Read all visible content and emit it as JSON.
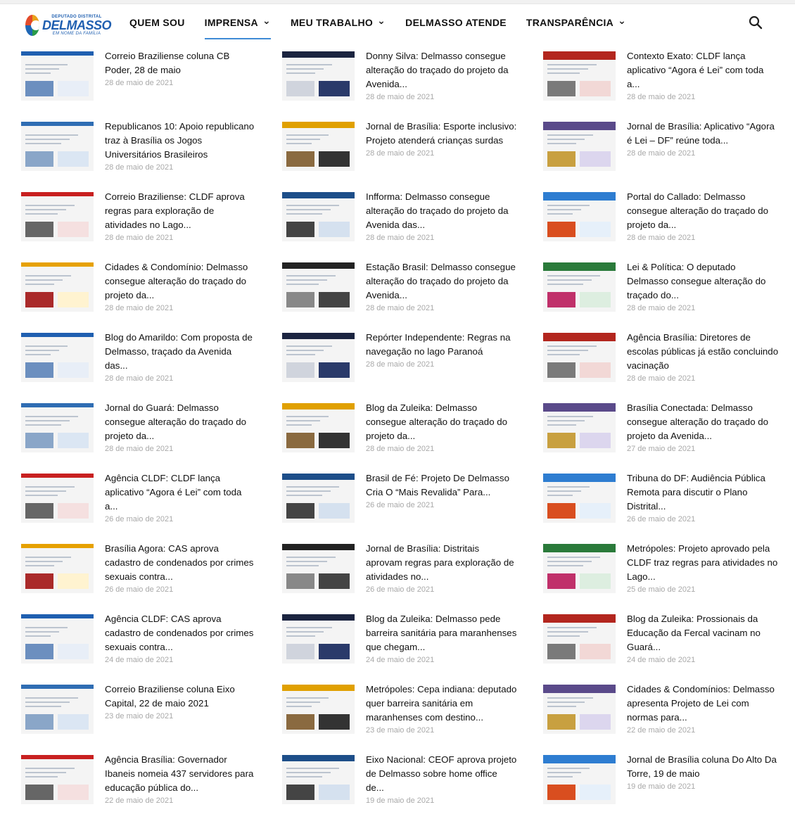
{
  "header": {
    "logo": {
      "top": "DEPUTADO DISTRITAL",
      "name": "DELMASSO",
      "sub": "EM NOME DA FAMÍLIA"
    },
    "nav": [
      {
        "label": "QUEM SOU",
        "dropdown": false,
        "active": false
      },
      {
        "label": "IMPRENSA",
        "dropdown": true,
        "active": true
      },
      {
        "label": "MEU TRABALHO",
        "dropdown": true,
        "active": false
      },
      {
        "label": "DELMASSO ATENDE",
        "dropdown": false,
        "active": false
      },
      {
        "label": "TRANSPARÊNCIA",
        "dropdown": true,
        "active": false
      }
    ],
    "search_icon": "search-icon",
    "accent_color": "#3f8bd5"
  },
  "posts": [
    {
      "title": "Correio Braziliense coluna CB Poder, 28 de maio",
      "date": "28 de maio de 2021"
    },
    {
      "title": "Donny Silva: Delmasso consegue alteração do traçado do projeto da Avenida...",
      "date": "28 de maio de 2021"
    },
    {
      "title": "Contexto Exato: CLDF lança aplicativo “Agora é Lei” com toda a...",
      "date": "28 de maio de 2021"
    },
    {
      "title": "Republicanos 10: Apoio republicano traz à Brasília os Jogos Universitários Brasileiros",
      "date": "28 de maio de 2021"
    },
    {
      "title": "Jornal de Brasília: Esporte inclusivo: Projeto atenderá crianças surdas",
      "date": "28 de maio de 2021"
    },
    {
      "title": "Jornal de Brasília: Aplicativo “Agora é Lei – DF” reúne toda...",
      "date": "28 de maio de 2021"
    },
    {
      "title": "Correio Braziliense: CLDF aprova regras para exploração de atividades no Lago...",
      "date": "28 de maio de 2021"
    },
    {
      "title": "Infforma: Delmasso consegue alteração do traçado do projeto da Avenida das...",
      "date": "28 de maio de 2021"
    },
    {
      "title": "Portal do Callado: Delmasso consegue alteração do traçado do projeto da...",
      "date": "28 de maio de 2021"
    },
    {
      "title": "Cidades & Condomínio: Delmasso consegue alteração do traçado do projeto da...",
      "date": "28 de maio de 2021"
    },
    {
      "title": "Estação Brasil: Delmasso consegue alteração do traçado do projeto da Avenida...",
      "date": "28 de maio de 2021"
    },
    {
      "title": "Lei & Política: O deputado Delmasso consegue alteração do traçado do...",
      "date": "28 de maio de 2021"
    },
    {
      "title": "Blog do Amarildo: Com proposta de Delmasso, traçado da Avenida das...",
      "date": "28 de maio de 2021"
    },
    {
      "title": "Repórter Independente: Regras na navegação no lago Paranoá",
      "date": "28 de maio de 2021"
    },
    {
      "title": "Agência Brasília: Diretores de escolas públicas já estão concluindo vacinação",
      "date": "28 de maio de 2021"
    },
    {
      "title": "Jornal do Guará: Delmasso consegue alteração do traçado do projeto da...",
      "date": "28 de maio de 2021"
    },
    {
      "title": "Blog da Zuleika: Delmasso consegue alteração do traçado do projeto da...",
      "date": "28 de maio de 2021"
    },
    {
      "title": "Brasília Conectada: Delmasso consegue alteração do traçado do projeto da Avenida...",
      "date": "27 de maio de 2021"
    },
    {
      "title": "Agência CLDF: CLDF lança aplicativo “Agora é Lei” com toda a...",
      "date": "26 de maio de 2021"
    },
    {
      "title": "Brasil de Fé: Projeto De Delmasso Cria O “Mais Revalida” Para...",
      "date": "26 de maio de 2021"
    },
    {
      "title": "Tribuna do DF: Audiência Pública Remota para discutir o Plano Distrital...",
      "date": "26 de maio de 2021"
    },
    {
      "title": "Brasília Agora: CAS aprova cadastro de condenados por crimes sexuais contra...",
      "date": "26 de maio de 2021"
    },
    {
      "title": "Jornal de Brasília: Distritais aprovam regras para exploração de atividades no...",
      "date": "26 de maio de 2021"
    },
    {
      "title": "Metrópoles: Projeto aprovado pela CLDF traz regras para atividades no Lago...",
      "date": "25 de maio de 2021"
    },
    {
      "title": "Agência CLDF: CAS aprova cadastro de condenados por crimes sexuais contra...",
      "date": "24 de maio de 2021"
    },
    {
      "title": "Blog da Zuleika: Delmasso pede barreira sanitária para maranhenses que chegam...",
      "date": "24 de maio de 2021"
    },
    {
      "title": "Blog da Zuleika: Prossionais da Educação da Fercal vacinam no Guará...",
      "date": "24 de maio de 2021"
    },
    {
      "title": "Correio Braziliense coluna Eixo Capital, 22 de maio 2021",
      "date": "23 de maio de 2021"
    },
    {
      "title": "Metrópoles: Cepa indiana: deputado quer barreira sanitária em maranhenses com destino...",
      "date": "23 de maio de 2021"
    },
    {
      "title": "Cidades & Condomínios: Delmasso apresenta Projeto de Lei com normas para...",
      "date": "22 de maio de 2021"
    },
    {
      "title": "Agência Brasília: Governador Ibaneis nomeia 437 servidores para educação pública do...",
      "date": "22 de maio de 2021"
    },
    {
      "title": "Eixo Nacional: CEOF aprova projeto de Delmasso sobre home office de...",
      "date": "19 de maio de 2021"
    },
    {
      "title": "Jornal de Brasília coluna Do Alto Da Torre, 19 de maio",
      "date": "19 de maio de 2021"
    }
  ]
}
